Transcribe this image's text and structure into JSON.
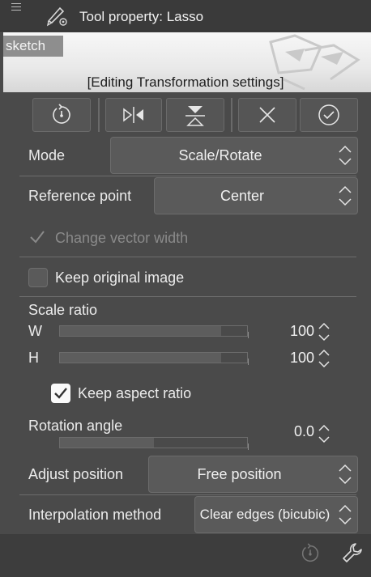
{
  "title": "Tool property: Lasso",
  "preview": {
    "tag": "sketch",
    "caption": "[Editing Transformation settings]"
  },
  "toolbar": [
    {
      "icon": "reset-icon"
    },
    {
      "icon": "flip-horizontal-icon"
    },
    {
      "icon": "flip-vertical-icon"
    },
    {
      "icon": "cancel-icon"
    },
    {
      "icon": "confirm-icon"
    }
  ],
  "mode": {
    "label": "Mode",
    "value": "Scale/Rotate"
  },
  "reference_point": {
    "label": "Reference point",
    "value": "Center"
  },
  "change_vector_width": {
    "label": "Change vector width",
    "checked": true,
    "disabled": true
  },
  "keep_original_image": {
    "label": "Keep original image",
    "checked": false
  },
  "scale_ratio": {
    "label": "Scale ratio",
    "w": {
      "label": "W",
      "value": "100",
      "level": 0.86
    },
    "h": {
      "label": "H",
      "value": "100",
      "level": 0.86
    },
    "keep_aspect": {
      "label": "Keep aspect ratio",
      "checked": true
    }
  },
  "rotation": {
    "label": "Rotation angle",
    "value": "0.0",
    "level": 0.5
  },
  "adjust_position": {
    "label": "Adjust position",
    "value": "Free position"
  },
  "interpolation": {
    "label": "Interpolation method",
    "value": "Clear edges (bicubic)"
  },
  "footer": {
    "icons": [
      "reset-icon",
      "wrench-icon"
    ]
  },
  "colors": {
    "panel": "#4a4a4a",
    "titlebar": "#3a3a3a",
    "control": "#5a5a5a",
    "text": "#ececec"
  }
}
